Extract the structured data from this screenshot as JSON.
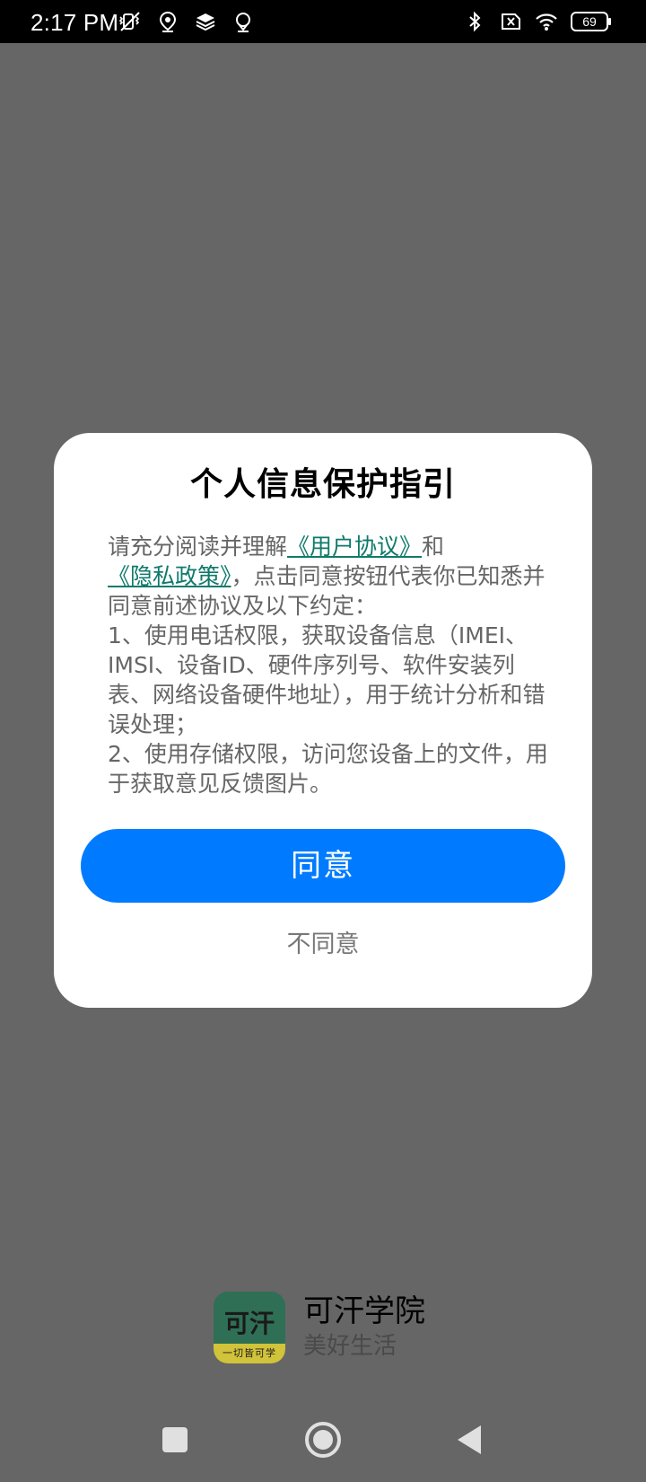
{
  "status_bar": {
    "time": "2:17 PM",
    "icons_left": [
      "mute-vibrate-icon",
      "location-pin-icon",
      "layers-icon",
      "map-pin-icon"
    ],
    "icons_right": [
      "bluetooth-icon",
      "sim-off-icon",
      "wifi-icon",
      "battery-icon"
    ],
    "battery_level": "69"
  },
  "dialog": {
    "title": "个人信息保护指引",
    "body": {
      "intro_prefix": "请充分阅读并理解",
      "user_agreement_link": "《用户协议》",
      "and_text": "和",
      "privacy_policy_link": "《隐私政策》",
      "intro_suffix": "，点击同意按钮代表你已知悉并同意前述协议及以下约定：",
      "item1": "1、使用电话权限，获取设备信息（IMEI、IMSI、设备ID、硬件序列号、软件安装列表、网络设备硬件地址），用于统计分析和错误处理；",
      "item2": "2、使用存储权限，访问您设备上的文件，用于获取意见反馈图片。"
    },
    "agree_label": "同意",
    "disagree_label": "不同意"
  },
  "app_brand": {
    "logo_main": "可汗",
    "logo_sub": "一切皆可学",
    "name": "可汗学院",
    "tagline": "美好生活"
  },
  "nav_bar": {
    "buttons": [
      "recent-apps",
      "home",
      "back"
    ]
  },
  "colors": {
    "backdrop": "#666666",
    "primary_button": "#007bff",
    "link": "#0f7a6b",
    "logo_green": "#2f6f56",
    "logo_yellow": "#d1c33a"
  }
}
